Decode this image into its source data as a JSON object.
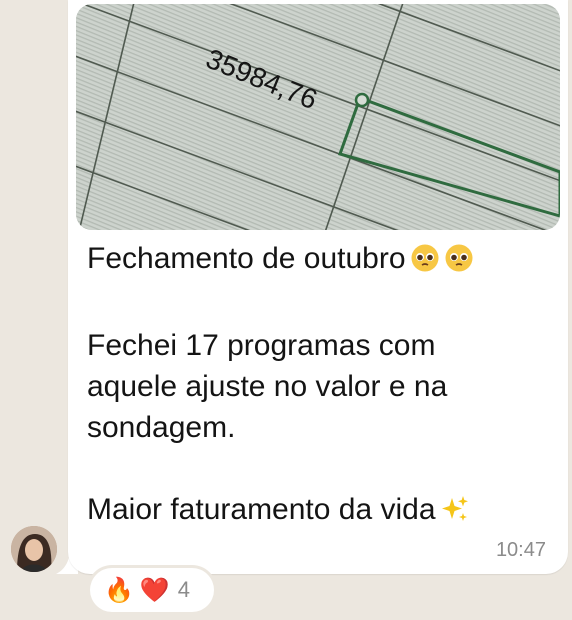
{
  "message": {
    "image_text": "35984,76",
    "line1": "Fechamento de outubro",
    "line2": "Fechei 17 programas com",
    "line3": "aquele ajuste no valor e na",
    "line4": "sondagem.",
    "line5": "Maior faturamento da vida",
    "time": "10:47"
  },
  "reactions": {
    "emojis": [
      "🔥",
      "❤️"
    ],
    "count": "4"
  },
  "icons": [
    "pleading-face-emoji",
    "sparkles-emoji",
    "avatar-photo"
  ],
  "colors": {
    "background": "#ece7df",
    "bubble": "#ffffff",
    "time": "#8b8b8b",
    "cell_border": "#2f6b3f"
  }
}
